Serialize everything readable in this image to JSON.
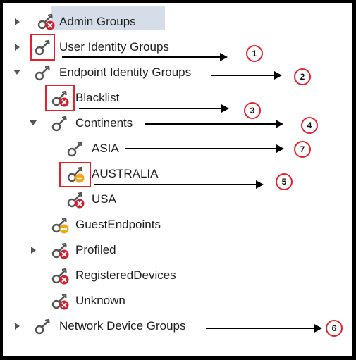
{
  "tree": {
    "items": [
      {
        "label": "Admin Groups",
        "level": 0,
        "toggle": "collapsed",
        "icon": "key-denied-icon",
        "selected": true
      },
      {
        "label": "User Identity Groups",
        "level": 0,
        "toggle": "collapsed",
        "icon": "key-icon"
      },
      {
        "label": "Endpoint Identity Groups",
        "level": 0,
        "toggle": "expanded",
        "icon": "key-icon"
      },
      {
        "label": "Blacklist",
        "level": 1,
        "toggle": "none",
        "icon": "key-denied-icon"
      },
      {
        "label": "Continents",
        "level": 1,
        "toggle": "expanded",
        "icon": "key-icon"
      },
      {
        "label": "ASIA",
        "level": 2,
        "toggle": "none",
        "icon": "key-icon"
      },
      {
        "label": "AUSTRALIA",
        "level": 2,
        "toggle": "none",
        "icon": "key-limited-icon"
      },
      {
        "label": "USA",
        "level": 2,
        "toggle": "none",
        "icon": "key-denied-icon"
      },
      {
        "label": "GuestEndpoints",
        "level": 1,
        "toggle": "none",
        "icon": "key-limited-icon"
      },
      {
        "label": "Profiled",
        "level": 1,
        "toggle": "collapsed",
        "icon": "key-denied-icon"
      },
      {
        "label": "RegisteredDevices",
        "level": 1,
        "toggle": "none",
        "icon": "key-denied-icon"
      },
      {
        "label": "Unknown",
        "level": 1,
        "toggle": "none",
        "icon": "key-denied-icon"
      },
      {
        "label": "Network Device Groups",
        "level": 0,
        "toggle": "collapsed",
        "icon": "key-icon"
      }
    ]
  },
  "annotations": {
    "callouts": [
      "1",
      "2",
      "3",
      "4",
      "7",
      "5",
      "6"
    ],
    "colors": {
      "callout_red": "#e8202a",
      "deny_badge": "#d0202e",
      "limited_badge": "#f0a818",
      "key_gray": "#555555",
      "selection_bg": "#d4dde8"
    }
  }
}
